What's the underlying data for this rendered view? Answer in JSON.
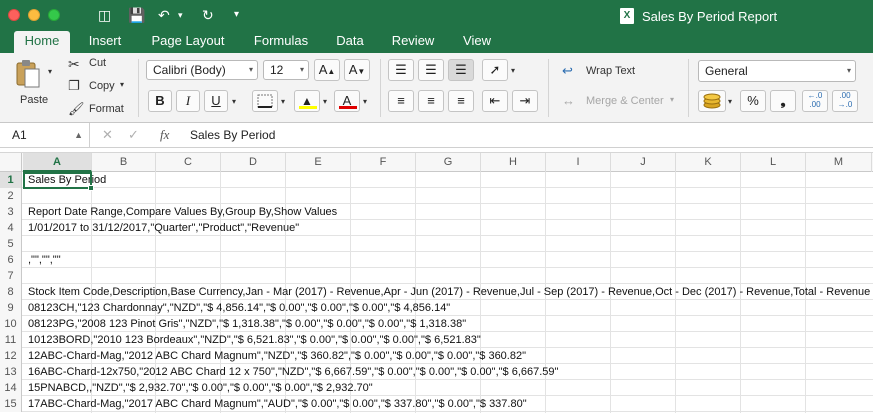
{
  "window": {
    "title": "Sales By Period Report",
    "doc_icon": "X"
  },
  "tabs": [
    "Home",
    "Insert",
    "Page Layout",
    "Formulas",
    "Data",
    "Review",
    "View"
  ],
  "ribbon": {
    "paste": "Paste",
    "cut": "Cut",
    "copy": "Copy",
    "format": "Format",
    "font_name": "Calibri (Body)",
    "font_size": "12",
    "bold": "B",
    "italic": "I",
    "underline": "U",
    "wrap_text": "Wrap Text",
    "merge_center": "Merge & Center",
    "number_format": "General",
    "percent": "%",
    "comma": "❟",
    "inc_decimal_top": "←.0",
    "inc_decimal_bottom": ".00",
    "dec_decimal_top": ".00",
    "dec_decimal_bottom": "→.0",
    "font_color": "#e00000",
    "fill_color": "#ffff00"
  },
  "formula_bar": {
    "cell_ref": "A1",
    "fx": "fx",
    "content": "Sales By Period"
  },
  "columns": [
    "A",
    "B",
    "C",
    "D",
    "E",
    "F",
    "G",
    "H",
    "I",
    "J",
    "K",
    "L",
    "M"
  ],
  "rows": [
    {
      "num": "1",
      "text": "Sales By Period"
    },
    {
      "num": "2",
      "text": ""
    },
    {
      "num": "3",
      "text": "Report Date Range,Compare Values By,Group By,Show Values"
    },
    {
      "num": "4",
      "text": "1/01/2017 to 31/12/2017,\"Quarter\",\"Product\",\"Revenue\""
    },
    {
      "num": "5",
      "text": ""
    },
    {
      "num": "6",
      "text": ",\"\",\"\",\"\""
    },
    {
      "num": "7",
      "text": ""
    },
    {
      "num": "8",
      "text": "Stock Item Code,Description,Base Currency,Jan - Mar (2017) - Revenue,Apr - Jun (2017) - Revenue,Jul - Sep (2017) - Revenue,Oct - Dec (2017) - Revenue,Total - Revenue"
    },
    {
      "num": "9",
      "text": "08123CH,\"123 Chardonnay\",\"NZD\",\"$ 4,856.14\",\"$ 0.00\",\"$ 0.00\",\"$ 0.00\",\"$ 4,856.14\""
    },
    {
      "num": "10",
      "text": "08123PG,\"2008 123 Pinot Gris\",\"NZD\",\"$ 1,318.38\",\"$ 0.00\",\"$ 0.00\",\"$ 0.00\",\"$ 1,318.38\""
    },
    {
      "num": "11",
      "text": "10123BORD,\"2010 123 Bordeaux\",\"NZD\",\"$ 6,521.83\",\"$ 0.00\",\"$ 0.00\",\"$ 0.00\",\"$ 6,521.83\""
    },
    {
      "num": "12",
      "text": "12ABC-Chard-Mag,\"2012 ABC Chard Magnum\",\"NZD\",\"$ 360.82\",\"$ 0.00\",\"$ 0.00\",\"$ 0.00\",\"$ 360.82\""
    },
    {
      "num": "13",
      "text": "16ABC-Chard-12x750,\"2012 ABC Chard 12 x 750\",\"NZD\",\"$ 6,667.59\",\"$ 0.00\",\"$ 0.00\",\"$ 0.00\",\"$ 6,667.59\""
    },
    {
      "num": "14",
      "text": "15PNABCD,,\"NZD\",\"$ 2,932.70\",\"$ 0.00\",\"$ 0.00\",\"$ 0.00\",\"$ 2,932.70\""
    },
    {
      "num": "15",
      "text": "17ABC-Chard-Mag,\"2017 ABC Chard Magnum\",\"AUD\",\"$ 0.00\",\"$ 0.00\",\"$ 337.80\",\"$ 0.00\",\"$ 337.80\""
    }
  ]
}
